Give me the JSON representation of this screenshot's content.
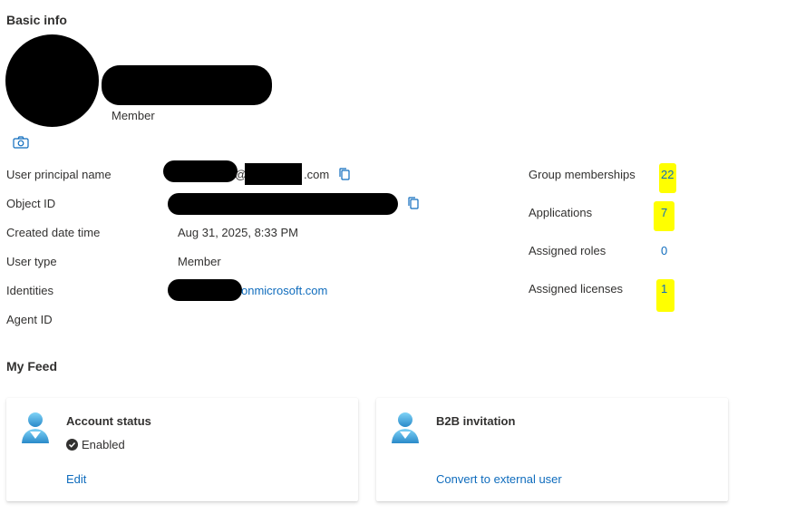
{
  "basic_info": {
    "title": "Basic info",
    "user_type_caption": "Member",
    "photo_icon": "camera-icon"
  },
  "properties": {
    "upn": {
      "label": "User principal name",
      "value_visible_fragment_1": "@",
      "value_visible_fragment_2": ".com"
    },
    "object_id": {
      "label": "Object ID"
    },
    "created": {
      "label": "Created date time",
      "value": "Aug 31, 2025, 8:33 PM"
    },
    "user_type": {
      "label": "User type",
      "value": "Member"
    },
    "identities": {
      "label": "Identities",
      "value_visible_fragment": "onmicrosoft.com"
    },
    "agent_id": {
      "label": "Agent ID"
    }
  },
  "stats": {
    "group_memberships": {
      "label": "Group memberships",
      "value": "22"
    },
    "applications": {
      "label": "Applications",
      "value": "7"
    },
    "assigned_roles": {
      "label": "Assigned roles",
      "value": "0"
    },
    "assigned_licenses": {
      "label": "Assigned licenses",
      "value": "1"
    }
  },
  "feed": {
    "title": "My Feed",
    "account_status": {
      "title": "Account status",
      "status": "Enabled",
      "action": "Edit"
    },
    "b2b": {
      "title": "B2B invitation",
      "action": "Convert to external user"
    }
  },
  "colors": {
    "link": "#0f6cbd",
    "text": "#323130",
    "highlight": "#ffff00",
    "redaction": "#000000"
  }
}
